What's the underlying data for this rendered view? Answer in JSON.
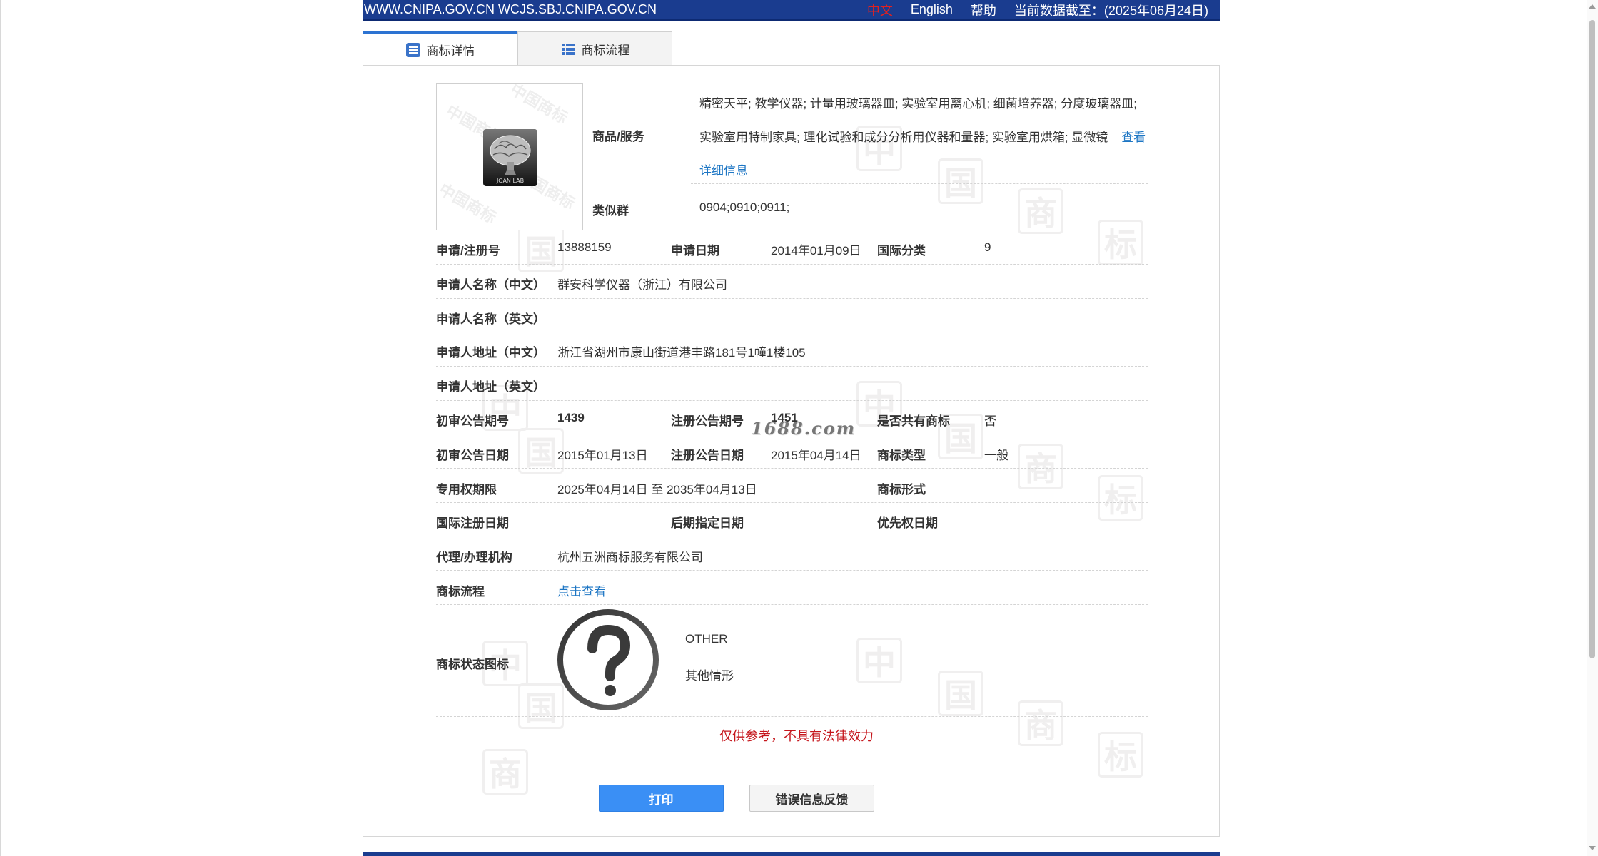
{
  "topbar": {
    "sites": "WWW.CNIPA.GOV.CN WCJS.SBJ.CNIPA.GOV.CN",
    "lang_zh": "中文",
    "lang_en": "English",
    "help": "帮助",
    "data_as_of": "当前数据截至：(2025年06月24日)"
  },
  "tabs": [
    {
      "label": "商标详情",
      "icon": "list-detail-icon",
      "active": true
    },
    {
      "label": "商标流程",
      "icon": "list-flow-icon",
      "active": false
    }
  ],
  "logo": {
    "text": "JOAN LAB",
    "icon": "brain-tree-logo"
  },
  "goods": {
    "label": "商品/服务",
    "text": "精密天平; 教学仪器; 计量用玻璃器皿; 实验室用离心机; 细菌培养器; 分度玻璃器皿; 实验室用特制家具; 理化试验和成分分析用仪器和量器; 实验室用烘箱; 显微镜",
    "more_link": "查看详细信息"
  },
  "similar_group": {
    "label": "类似群",
    "value": "0904;0910;0911;"
  },
  "application": {
    "reg_no_label": "申请/注册号",
    "reg_no": "13888159",
    "app_date_label": "申请日期",
    "app_date": "2014年01月09日",
    "intl_class_label": "国际分类",
    "intl_class": "9"
  },
  "applicant": {
    "name_cn_label": "申请人名称（中文）",
    "name_cn": "群安科学仪器（浙江）有限公司",
    "name_en_label": "申请人名称（英文）",
    "name_en": "",
    "addr_cn_label": "申请人地址（中文）",
    "addr_cn": "浙江省湖州市康山街道港丰路181号1幢1楼105",
    "addr_en_label": "申请人地址（英文）",
    "addr_en": ""
  },
  "announcements": {
    "prelim_no_label": "初审公告期号",
    "prelim_no": "1439",
    "reg_no_label": "注册公告期号",
    "reg_no": "1451",
    "shared_label": "是否共有商标",
    "shared": "否",
    "prelim_date_label": "初审公告日期",
    "prelim_date": "2015年01月13日",
    "reg_date_label": "注册公告日期",
    "reg_date": "2015年04月14日",
    "type_label": "商标类型",
    "type": "一般"
  },
  "rights": {
    "period_label": "专用权期限",
    "period": "2025年04月14日 至 2035年04月13日",
    "form_label": "商标形式",
    "form": "",
    "intl_reg_date_label": "国际注册日期",
    "intl_reg_date": "",
    "later_date_label": "后期指定日期",
    "later_date": "",
    "priority_label": "优先权日期",
    "priority": ""
  },
  "agent": {
    "label": "代理/办理机构",
    "value": "杭州五洲商标服务有限公司"
  },
  "flow": {
    "label": "商标流程",
    "link": "点击查看"
  },
  "status": {
    "label": "商标状态图标",
    "code": "OTHER",
    "text": "其他情形",
    "icon": "question-mark-icon"
  },
  "disclaimer": "仅供参考，不具有法律效力",
  "buttons": {
    "print": "打印",
    "feedback": "错误信息反馈"
  },
  "watermark": {
    "text": "1688.com",
    "char1": "中",
    "char2": "国",
    "char3": "商",
    "char4": "标",
    "logo_faint": "中国商标"
  },
  "colors": {
    "topbar": "#1a3c8f",
    "link": "#1d76c4",
    "disclaimer": "#c5161c",
    "print_button": "#3a8ff5",
    "lang_zh": "#e3211f"
  }
}
